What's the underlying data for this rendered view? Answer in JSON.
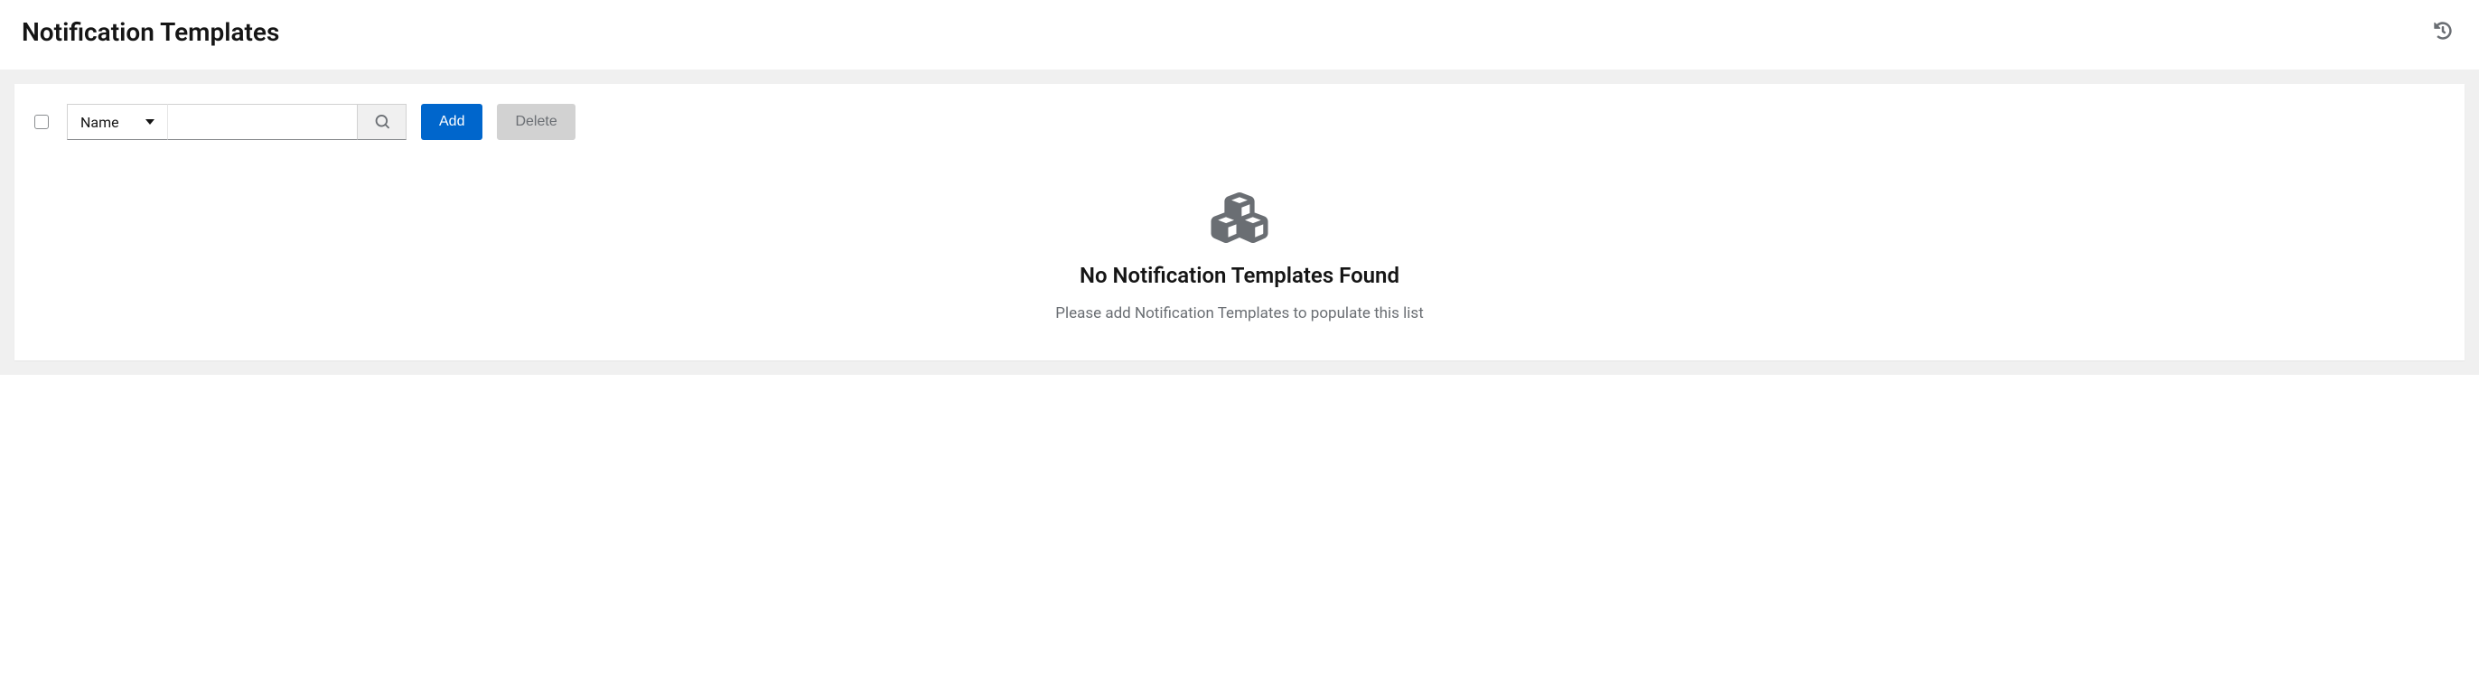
{
  "header": {
    "title": "Notification Templates"
  },
  "toolbar": {
    "filter_field": "Name",
    "search_value": "",
    "add_label": "Add",
    "delete_label": "Delete"
  },
  "empty_state": {
    "title": "No Notification Templates Found",
    "description": "Please add Notification Templates to populate this list"
  }
}
